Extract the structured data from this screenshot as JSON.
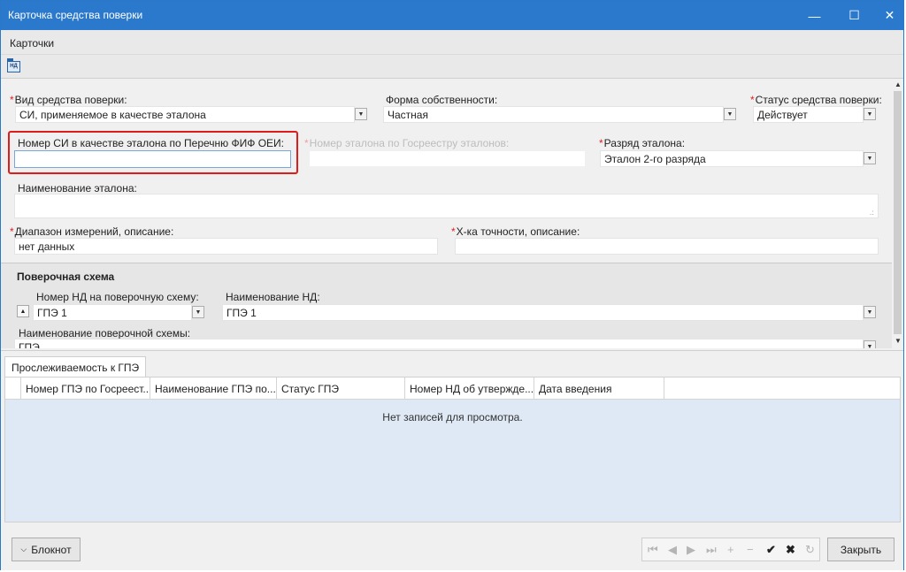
{
  "window": {
    "title": "Карточка средства поверки",
    "min": "—",
    "max": "☐",
    "close": "✕"
  },
  "menu": {
    "items": [
      "Карточки"
    ]
  },
  "toolbar": {
    "icon_name": "nd-document-icon",
    "icon_text": "НД"
  },
  "form": {
    "vid": {
      "label": "Вид средства поверки:",
      "value": "СИ, применяемое в качестве эталона"
    },
    "forma": {
      "label": "Форма собственности:",
      "value": "Частная"
    },
    "status": {
      "label": "Статус средства поверки:",
      "value": "Действует"
    },
    "nomer_si": {
      "label": "Номер СИ в качестве эталона по Перечню ФИФ ОЕИ:",
      "value": ""
    },
    "nomer_gos": {
      "label": "Номер эталона по Госреестру эталонов:",
      "value": ""
    },
    "razryad": {
      "label": "Разряд эталона:",
      "value": "Эталон 2-го разряда"
    },
    "naim": {
      "label": "Наименование эталона:",
      "value": ""
    },
    "diapazon": {
      "label": "Диапазон измерений, описание:",
      "value": "нет данных"
    },
    "xka": {
      "label": "Х-ка точности, описание:",
      "value": ""
    },
    "req_mark": "*"
  },
  "poverka": {
    "title": "Поверочная схема",
    "nomer_nd_label": "Номер НД на поверочную схему:",
    "nomer_nd_value": "ГПЭ 1",
    "naim_nd_label": "Наименование НД:",
    "naim_nd_value": "ГПЭ 1",
    "naim_schema_label": "Наименование поверочной схемы:",
    "naim_schema_value": "ГПЭ"
  },
  "tabs": [
    "Прослеживаемость к ГПЭ"
  ],
  "grid": {
    "columns": [
      "Номер ГПЭ по Госреест...",
      "Наименование ГПЭ по...",
      "Статус ГПЭ",
      "Номер НД об утвержде...",
      "Дата введения"
    ],
    "empty_text": "Нет записей для просмотра."
  },
  "bottom": {
    "notepad_label": "Блокнот",
    "close_label": "Закрыть",
    "nav": [
      "⏮",
      "◀",
      "▶",
      "⏭",
      "+",
      "−",
      "✔",
      "✖",
      "↻"
    ]
  }
}
